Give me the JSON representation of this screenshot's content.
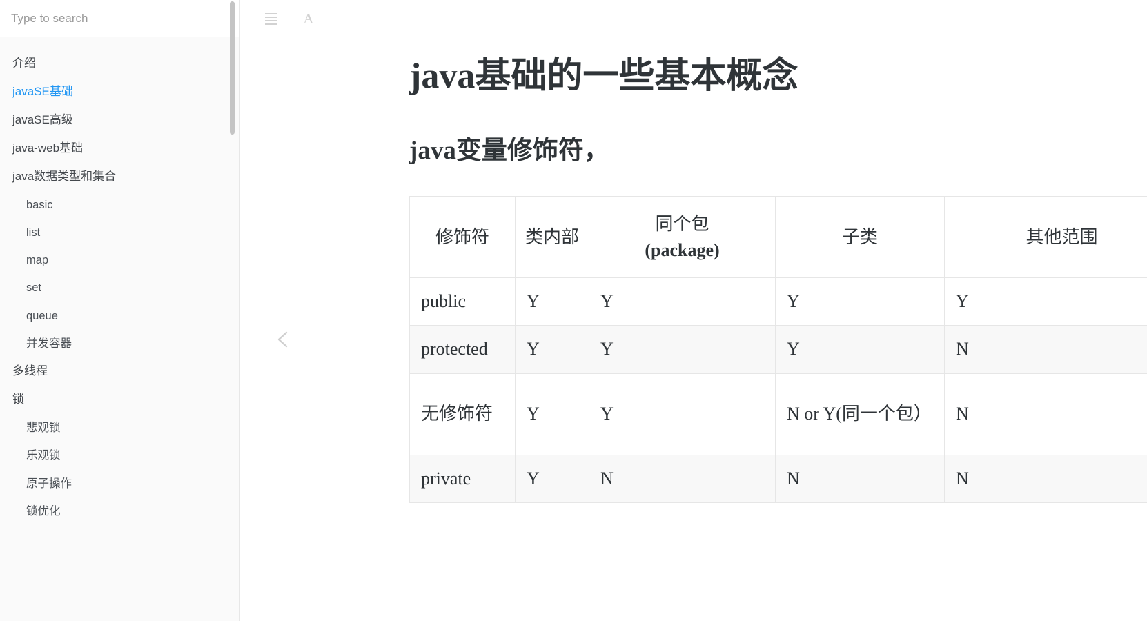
{
  "sidebar": {
    "search": {
      "placeholder": "Type to search",
      "value": ""
    },
    "items": [
      {
        "label": "介绍",
        "level": 0,
        "active": false
      },
      {
        "label": "javaSE基础",
        "level": 0,
        "active": true
      },
      {
        "label": "javaSE高级",
        "level": 0,
        "active": false
      },
      {
        "label": "java-web基础",
        "level": 0,
        "active": false
      },
      {
        "label": "java数据类型和集合",
        "level": 0,
        "active": false
      },
      {
        "label": "basic",
        "level": 1,
        "active": false
      },
      {
        "label": "list",
        "level": 1,
        "active": false
      },
      {
        "label": "map",
        "level": 1,
        "active": false
      },
      {
        "label": "set",
        "level": 1,
        "active": false
      },
      {
        "label": "queue",
        "level": 1,
        "active": false
      },
      {
        "label": "并发容器",
        "level": 1,
        "active": false
      },
      {
        "label": "多线程",
        "level": 0,
        "active": false
      },
      {
        "label": "锁",
        "level": 0,
        "active": false
      },
      {
        "label": "悲观锁",
        "level": 1,
        "active": false
      },
      {
        "label": "乐观锁",
        "level": 1,
        "active": false
      },
      {
        "label": "原子操作",
        "level": 1,
        "active": false
      },
      {
        "label": "锁优化",
        "level": 1,
        "active": false
      }
    ],
    "active_color": "#2196f3"
  },
  "toolbar": {
    "menu_icon": "hamburger-icon",
    "font_size_icon": "font-size-icon",
    "font_size_label": "A"
  },
  "collapse": {
    "icon": "chevron-left-icon"
  },
  "document": {
    "title": "java基础的一些基本概念",
    "subtitle": "java变量修饰符，"
  },
  "table": {
    "headers": [
      {
        "text": "修饰符",
        "bold_part": ""
      },
      {
        "text": "类内部",
        "bold_part": ""
      },
      {
        "text": "同个包",
        "bold_part": "(package)"
      },
      {
        "text": "子类",
        "bold_part": ""
      },
      {
        "text": "其他范围",
        "bold_part": ""
      }
    ],
    "rows": [
      {
        "tall": false,
        "cells": [
          "public",
          "Y",
          "Y",
          "Y",
          "Y"
        ]
      },
      {
        "tall": false,
        "cells": [
          "protected",
          "Y",
          "Y",
          "Y",
          "N"
        ]
      },
      {
        "tall": true,
        "cells": [
          "无修饰符",
          "Y",
          "Y",
          "N or Y(同一个包）",
          "N"
        ]
      },
      {
        "tall": false,
        "cells": [
          "private",
          "Y",
          "N",
          "N",
          "N"
        ]
      }
    ]
  }
}
